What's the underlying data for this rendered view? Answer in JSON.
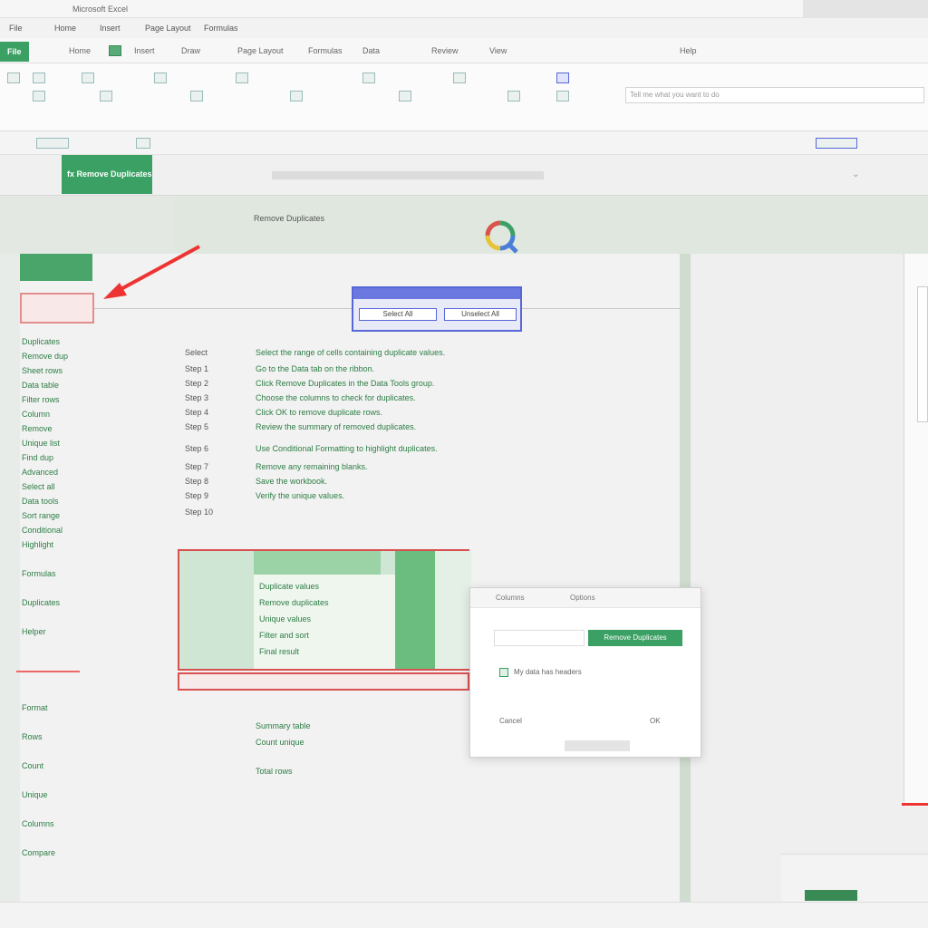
{
  "titlebar": {
    "title": "Microsoft Excel"
  },
  "menu": {
    "items": [
      "File",
      "Home",
      "Insert",
      "Page Layout",
      "Formulas",
      "Data",
      "Review",
      "View"
    ]
  },
  "ribbon": {
    "tabs": [
      "File",
      "Home",
      "Insert",
      "Draw",
      "Page Layout",
      "Formulas",
      "Data",
      "Review",
      "View",
      "Help"
    ],
    "active_tab": "Home",
    "search_placeholder": "Tell me what you want to do"
  },
  "formula_bar": {
    "name_box": "fx Remove Duplicates"
  },
  "header_band": {
    "label": "Remove Duplicates",
    "logo": "Q"
  },
  "sheet": {
    "left_list": [
      "Duplicates",
      "Remove dup",
      "Sheet rows",
      "Data table",
      "Filter rows",
      "Column",
      "Remove",
      "Unique list",
      "Find dup",
      "Advanced",
      "Select all",
      "Data tools",
      "Sort range",
      "Conditional",
      "Highlight",
      "Formulas",
      "Duplicates",
      "Helper",
      "Format",
      "Rows",
      "Count",
      "Unique",
      "Columns",
      "Compare"
    ],
    "col_b": [
      "Select",
      "Step 1",
      "Step 2",
      "Step 3",
      "Step 4",
      "Step 5",
      "Step 6",
      "Step 7",
      "Step 8",
      "Step 9",
      "Step 10"
    ],
    "col_c": [
      "Select the range of cells containing duplicate values.",
      "Go to the Data tab on the ribbon.",
      "Click Remove Duplicates in the Data Tools group.",
      "Choose the columns to check for duplicates.",
      "Click OK to remove duplicate rows.",
      "Review the summary of removed duplicates.",
      "Use Conditional Formatting to highlight duplicates.",
      "Remove any remaining blanks.",
      "Save the workbook.",
      "Verify the unique values."
    ],
    "block_rows": [
      "Duplicate values",
      "Remove duplicates",
      "Unique values",
      "Filter and sort",
      "Final result"
    ],
    "bottom_rows": [
      "Summary table",
      "Count unique",
      "Total rows"
    ]
  },
  "dropdown": {
    "btn1": "Select All",
    "btn2": "Unselect All"
  },
  "popup": {
    "tab1": "Columns",
    "tab2": "Options",
    "button": "Remove Duplicates",
    "checkbox_label": "My data has headers",
    "ok": "OK",
    "cancel": "Cancel"
  },
  "colors": {
    "accent": "#3aa063",
    "highlight": "#d95050",
    "dropdown": "#5867d8"
  }
}
